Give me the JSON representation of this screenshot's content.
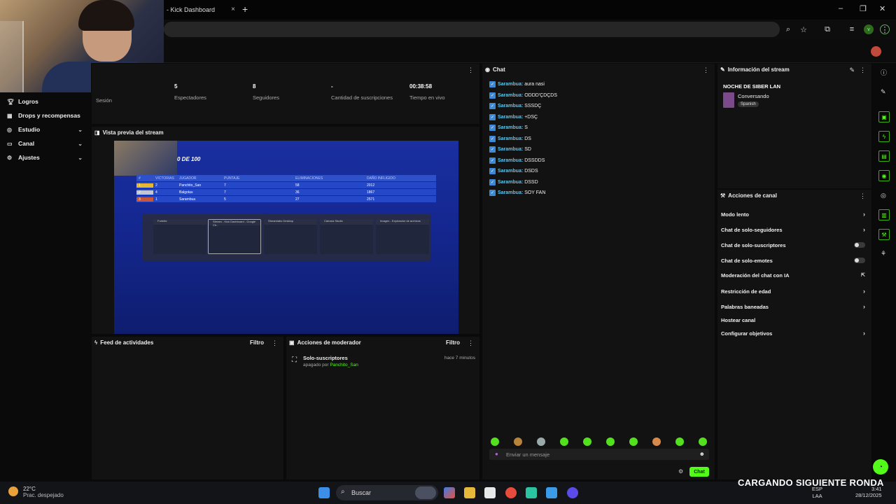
{
  "browser": {
    "tab_title": "- Kick Dashboard",
    "tab_close": "×",
    "new_tab": "+",
    "window_minimize": "–",
    "window_maximize": "❐",
    "window_close": "✕"
  },
  "sidebar": {
    "items": [
      {
        "label": "Logros",
        "icon": "trophy-icon"
      },
      {
        "label": "Drops y recompensas",
        "icon": "gift-icon"
      },
      {
        "label": "Estudio",
        "icon": "studio-icon"
      },
      {
        "label": "Canal",
        "icon": "channel-icon"
      },
      {
        "label": "Ajustes",
        "icon": "gear-icon"
      }
    ]
  },
  "stats": {
    "items": [
      {
        "value": "",
        "label": "Sesión"
      },
      {
        "value": "5",
        "label": "Espectadores"
      },
      {
        "value": "8",
        "label": "Seguidores"
      },
      {
        "value": "-",
        "label": "Cantidad de suscripciones"
      },
      {
        "value": "00:38:58",
        "label": "Tiempo en vivo"
      }
    ]
  },
  "preview": {
    "title": "Vista previa del stream",
    "overlay_title": "0 DE 100",
    "score_headers": [
      "#",
      "VICTORIAS",
      "JUGADOR",
      "PUNTAJE",
      "ELIMINACIONES",
      "DAÑO INFLIGIDO"
    ],
    "score_rows": [
      [
        "1",
        "2",
        "Panchito_San",
        "7",
        "58",
        "2012"
      ],
      [
        "2",
        "4",
        "Balgotas",
        "7",
        "36",
        "1867"
      ],
      [
        "3",
        "1",
        "Sarambua",
        "5",
        "27",
        "2571"
      ]
    ],
    "switcher_windows": [
      "Fortnite",
      "Stream - Kick Dashboard - Google Ch...",
      "Streamlabs Desktop",
      "Cámara Studio",
      "Imagen - Explorador de archivos"
    ]
  },
  "feed": {
    "title": "Feed de actividades",
    "filter": "Filtro"
  },
  "moderator": {
    "title": "Acciones de moderador",
    "filter": "Filtro",
    "action": "Solo-suscriptores",
    "detail_prefix": "apagado por",
    "detail_user": "Panchito_San",
    "time": "hace 7 minutos"
  },
  "chat": {
    "title": "Chat",
    "messages": [
      {
        "user": "Sarambua:",
        "text": "aura nasi"
      },
      {
        "user": "Sarambua:",
        "text": "ODDD'ÇDÇDS"
      },
      {
        "user": "Sarambua:",
        "text": "SSSDÇ"
      },
      {
        "user": "Sarambua:",
        "text": "+DSÇ"
      },
      {
        "user": "Sarambua:",
        "text": "S"
      },
      {
        "user": "Sarambua:",
        "text": "DS"
      },
      {
        "user": "Sarambua:",
        "text": "SD"
      },
      {
        "user": "Sarambua:",
        "text": "DSSDDS"
      },
      {
        "user": "Sarambua:",
        "text": "DSDS"
      },
      {
        "user": "Sarambua:",
        "text": "DSSD"
      },
      {
        "user": "Sarambua:",
        "text": "SOY FAN"
      }
    ],
    "input_placeholder": "Enviar un mensaje",
    "send_label": "Chat"
  },
  "stream_info": {
    "title": "Información del stream",
    "stream_title": "NOCHE DE SIBER LAN",
    "category": "Conversando",
    "language": "Spanish"
  },
  "channel_actions": {
    "title": "Acciones de canal",
    "items": [
      {
        "label": "Modo lento",
        "control": "chevron"
      },
      {
        "label": "Chat de solo-seguidores",
        "control": "chevron"
      },
      {
        "label": "Chat de solo-suscriptores",
        "control": "toggle",
        "on": false
      },
      {
        "label": "Chat de solo-emotes",
        "control": "toggle",
        "on": false
      },
      {
        "label": "Moderación del chat con IA",
        "control": "external"
      },
      {
        "label": "Restricción de edad",
        "control": "chevron"
      },
      {
        "label": "Palabras baneadas",
        "control": "chevron"
      },
      {
        "label": "Hostear canal",
        "control": "none"
      },
      {
        "label": "Configurar objetivos",
        "control": "chevron"
      }
    ]
  },
  "taskbar": {
    "temperature": "22°C",
    "weather": "Prac. despejado",
    "search": "Buscar",
    "overlay_text": "CARGANDO SIGUIENTE RONDA",
    "lang_top": "ESP",
    "lang_bottom": "LAA",
    "time": "3:41",
    "date": "28/12/2025"
  },
  "colors": {
    "accent": "#53fc18",
    "username": "#58c7f0",
    "panel": "#121212"
  }
}
